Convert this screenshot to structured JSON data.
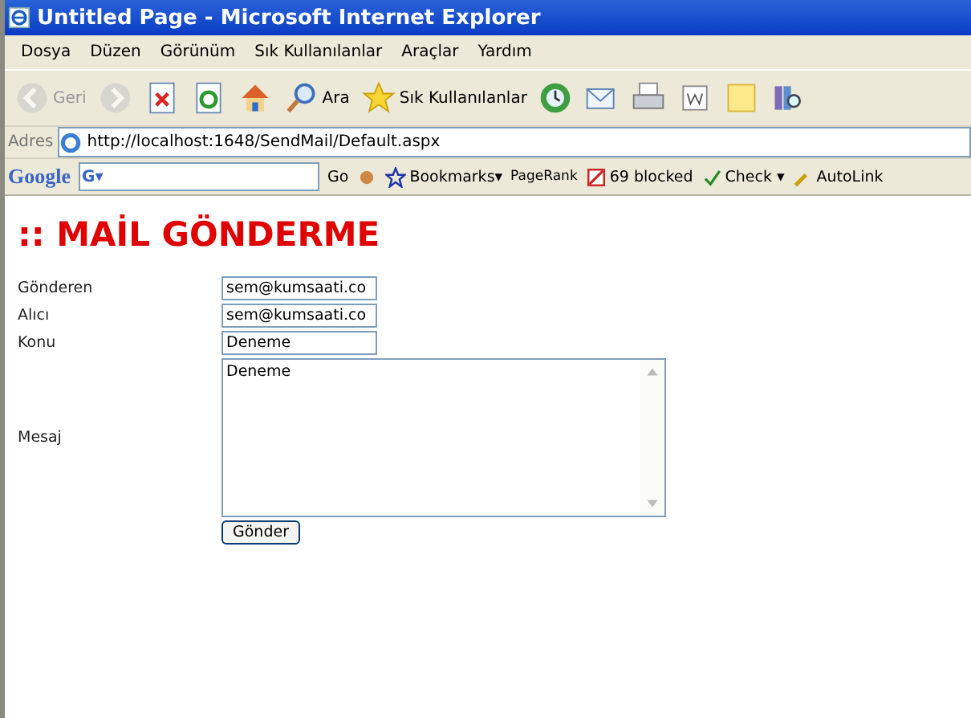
{
  "window": {
    "title": "Untitled Page - Microsoft Internet Explorer"
  },
  "menu": [
    "Dosya",
    "Düzen",
    "Görünüm",
    "Sık Kullanılanlar",
    "Araçlar",
    "Yardım"
  ],
  "toolbar": [
    {
      "kind": "back",
      "label": "Geri",
      "disabled": true
    },
    {
      "kind": "forward",
      "disabled": true
    },
    {
      "kind": "stop",
      "disabled": false
    },
    {
      "kind": "refresh",
      "disabled": false
    },
    {
      "kind": "home",
      "disabled": false
    },
    {
      "kind": "search",
      "label": "Ara",
      "disabled": false
    },
    {
      "kind": "favorites",
      "label": "Sık Kullanılanlar",
      "disabled": false
    },
    {
      "kind": "history",
      "disabled": false
    },
    {
      "kind": "mail",
      "disabled": false
    },
    {
      "kind": "print",
      "disabled": false
    },
    {
      "kind": "edit",
      "disabled": false
    },
    {
      "kind": "note",
      "disabled": false
    },
    {
      "kind": "research",
      "disabled": false
    }
  ],
  "address": {
    "label": "Adres",
    "value": "http://localhost:1648/SendMail/Default.aspx"
  },
  "google_bar": {
    "logo": "Google",
    "search_menu": "G▾",
    "go": "Go",
    "bookmarks": "Bookmarks▾",
    "pagerank": "PageRank",
    "blocked": "69 blocked",
    "check": "Check ▾",
    "autolink": "AutoLink"
  },
  "page": {
    "heading": ":: MAİL GÖNDERME",
    "fields": [
      {
        "label": "Gönderen",
        "value": "sem@kumsaati.co"
      },
      {
        "label": "Alıcı",
        "value": "sem@kumsaati.co"
      },
      {
        "label": "Konu",
        "value": "Deneme"
      }
    ],
    "message": {
      "label": "Mesaj",
      "value": "Deneme"
    },
    "submit": "Gönder"
  }
}
